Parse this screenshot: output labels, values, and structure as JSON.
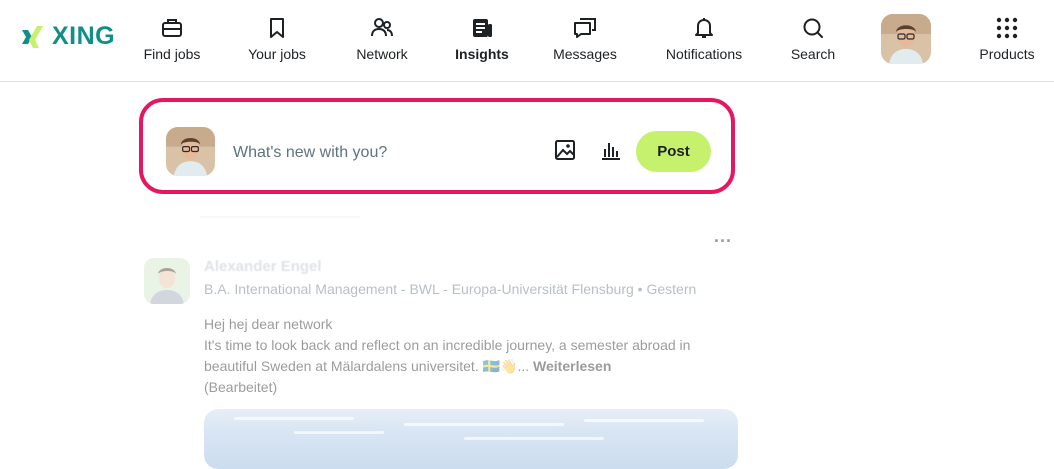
{
  "logo": {
    "word": "XING"
  },
  "nav": {
    "find_jobs": "Find jobs",
    "your_jobs": "Your jobs",
    "network": "Network",
    "insights": "Insights",
    "messages": "Messages",
    "notifications": "Notifications",
    "search": "Search",
    "products": "Products",
    "active": "Insights"
  },
  "composer": {
    "placeholder": "What's new with you?",
    "post_label": "Post"
  },
  "feed": {
    "author": "Alexander Engel",
    "meta": "B.A. International Management - BWL - Europa-Universität Flensburg • Gestern",
    "line1": "Hej hej dear network",
    "line2": "It's time to look back and reflect on an incredible journey, a semester abroad in",
    "line3": "beautiful Sweden at Mälardalens universitet. 🇸🇪👋...",
    "read_more": "Weiterlesen",
    "edited": "(Bearbeitet)",
    "more_menu": "..."
  },
  "colors": {
    "brand_teal": "#0f8f8a",
    "brand_lime": "#c6f16d",
    "highlight": "#e51760"
  }
}
